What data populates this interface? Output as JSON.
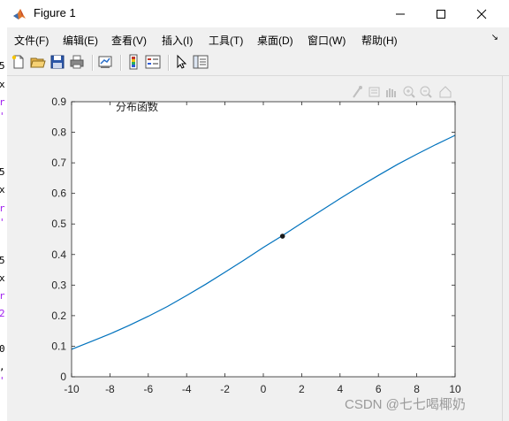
{
  "window": {
    "title": "Figure 1"
  },
  "menu": [
    "文件(F)",
    "编辑(E)",
    "查看(V)",
    "插入(I)",
    "工具(T)",
    "桌面(D)",
    "窗口(W)",
    "帮助(H)"
  ],
  "menu_arrow": "↘",
  "left_code_fragments": [
    "5",
    "x",
    "r",
    "'",
    "5",
    "x",
    "r",
    "'",
    "5",
    "x",
    "r",
    "2",
    "0",
    ",",
    "'"
  ],
  "plot": {
    "annotation": "分布函数",
    "x_ticks": [
      "-10",
      "-8",
      "-6",
      "-4",
      "-2",
      "0",
      "2",
      "4",
      "6",
      "8",
      "10"
    ],
    "y_ticks": [
      "0",
      "0.1",
      "0.2",
      "0.3",
      "0.4",
      "0.5",
      "0.6",
      "0.7",
      "0.8",
      "0.9"
    ]
  },
  "chart_data": {
    "type": "line",
    "title": "",
    "xlabel": "",
    "ylabel": "",
    "xlim": [
      -10,
      10
    ],
    "ylim": [
      0,
      0.9
    ],
    "grid": false,
    "line_color": "#0072bd",
    "series": [
      {
        "x": [
          -10,
          -9,
          -8,
          -7,
          -6,
          -5,
          -4,
          -3,
          -2,
          -1,
          0,
          1,
          2,
          3,
          4,
          5,
          6,
          7,
          8,
          9,
          10
        ],
        "values": [
          0.09,
          0.115,
          0.14,
          0.168,
          0.198,
          0.23,
          0.266,
          0.303,
          0.342,
          0.382,
          0.423,
          0.462,
          0.503,
          0.543,
          0.583,
          0.622,
          0.659,
          0.695,
          0.728,
          0.76,
          0.79
        ]
      }
    ],
    "marker_point": {
      "x": 1,
      "y": 0.46,
      "color": "#1a1a1a"
    }
  },
  "watermark": "CSDN @七七喝椰奶"
}
